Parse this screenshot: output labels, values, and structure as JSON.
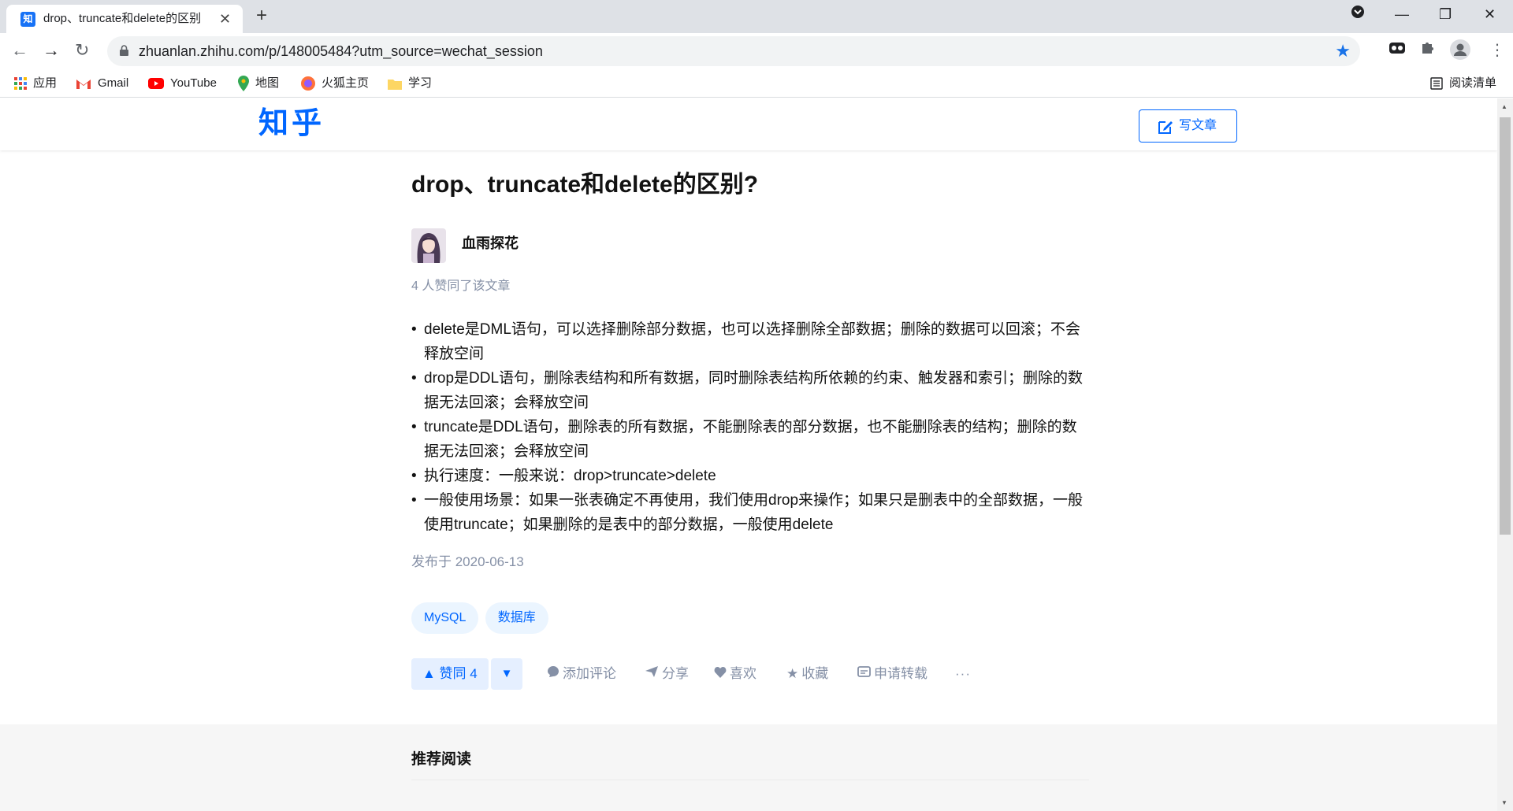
{
  "browser": {
    "tab_title": "drop、truncate和delete的区别",
    "tab_favicon_text": "知",
    "url": "zhuanlan.zhihu.com/p/148005484?utm_source=wechat_session",
    "bookmarks": [
      {
        "label": "应用",
        "icon": "apps-grid-icon"
      },
      {
        "label": "Gmail",
        "icon": "gmail-icon"
      },
      {
        "label": "YouTube",
        "icon": "youtube-icon"
      },
      {
        "label": "地图",
        "icon": "maps-pin-icon"
      },
      {
        "label": "火狐主页",
        "icon": "firefox-icon"
      },
      {
        "label": "学习",
        "icon": "folder-icon"
      }
    ],
    "reading_list_label": "阅读清单"
  },
  "site": {
    "logo": "知乎",
    "write_button": "写文章",
    "brand_color": "#0066ff"
  },
  "article": {
    "title": "drop、truncate和delete的区别?",
    "author": "血雨探花",
    "likes_note": "4 人赞同了该文章",
    "bullets": [
      "delete是DML语句，可以选择删除部分数据，也可以选择删除全部数据；删除的数据可以回滚；不会释放空间",
      "drop是DDL语句，删除表结构和所有数据，同时删除表结构所依赖的约束、触发器和索引；删除的数据无法回滚；会释放空间",
      "truncate是DDL语句，删除表的所有数据，不能删除表的部分数据，也不能删除表的结构；删除的数据无法回滚；会释放空间",
      "执行速度：一般来说：drop>truncate>delete",
      "一般使用场景：如果一张表确定不再使用，我们使用drop来操作；如果只是删表中的全部数据，一般使用truncate；如果删除的是表中的部分数据，一般使用delete"
    ],
    "published": "发布于 2020-06-13",
    "tags": [
      "MySQL",
      "数据库"
    ]
  },
  "actions": {
    "vote_up": "▲ 赞同 4",
    "vote_down": "▼",
    "comment": "添加评论",
    "share": "分享",
    "like": "喜欢",
    "collect": "收藏",
    "repost": "申请转载",
    "more": "···"
  },
  "recommend": {
    "title": "推荐阅读"
  }
}
